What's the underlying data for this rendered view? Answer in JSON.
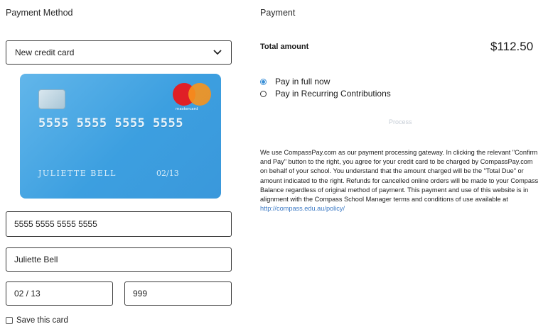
{
  "left": {
    "heading": "Payment Method",
    "card_select": {
      "value": "New credit card"
    },
    "card_preview": {
      "number": "5555 5555 5555 5555",
      "holder": "JULIETTE BELL",
      "expiry": "02/13",
      "brand_label": "mastercard"
    },
    "fields": {
      "card_number": "5555 5555 5555 5555",
      "cardholder_name": "Juliette Bell",
      "expiry": "02 / 13",
      "cvv": "999"
    },
    "save_card_label": "Save this card"
  },
  "right": {
    "heading": "Payment",
    "total_label": "Total amount",
    "total_value": "$112.50",
    "options": [
      {
        "label": "Pay in full now",
        "selected": true
      },
      {
        "label": "Pay in Recurring Contributions",
        "selected": false
      }
    ],
    "process_label": "Process",
    "notice_text": "We use CompassPay.com as our payment processing gateway. In clicking the relevant \"Confirm and Pay\" button to the right, you agree for your credit card to be charged by CompassPay.com on behalf of your school. You understand that the amount charged will be the \"Total Due\" or amount indicated to the right. Refunds for cancelled online orders will be made to your Compass Balance regardless of original method of payment. This payment and use of this website is in alignment with the Compass School Manager terms and conditions of use available at",
    "notice_link": "http://compass.edu.au/policy/"
  },
  "colors": {
    "card_blue": "#3c9fe0",
    "radio_accent": "#3a8fd6",
    "link": "#3a78c4",
    "mastercard_red": "#e01f26",
    "mastercard_orange": "#f7931d"
  },
  "icons": {
    "select_chevron": "chevron-down-icon",
    "card_chip": "chip-icon",
    "card_brand": "mastercard-logo"
  }
}
